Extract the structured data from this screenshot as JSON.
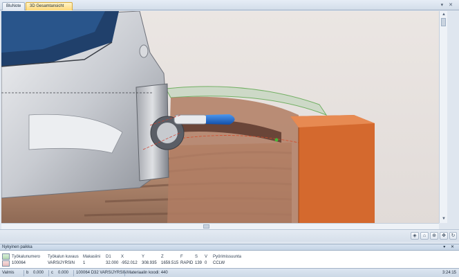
{
  "tabs": [
    {
      "label": "BluNote"
    },
    {
      "label": "3D Gesamtansicht"
    }
  ],
  "panel": {
    "title": "Nykyinen paikka",
    "columns": [
      "Työkalunumero",
      "Työkalun kuvaus",
      "Makasiini",
      "D1",
      "X",
      "Y",
      "Z",
      "F",
      "S",
      "V",
      "Pyörimissuunta"
    ],
    "row": [
      "100064",
      "VARSIJYRSIN",
      "1",
      "32.000",
      "-952.012",
      "308.935",
      "1659.515",
      "RAPID",
      "139",
      "0",
      "CCLW"
    ]
  },
  "status": {
    "left": "Valmis",
    "b_label": "b",
    "b_value": "0.000",
    "c_label": "c",
    "c_value": "0.000",
    "tool_info": "100064 D32 VARSIJYRSIN",
    "material_code": "Materiaalin koodi: 440",
    "time": "3:24:15"
  },
  "icons": {
    "view_tools": [
      "camera-icon",
      "home-icon",
      "zoom-icon",
      "pan-icon",
      "rotate-icon"
    ]
  },
  "colors": {
    "tab_active": "#ffd97a",
    "workpiece": "#d4692e",
    "tool_blue": "#1f6ed1",
    "machine_grey": "#c9ccd2"
  }
}
